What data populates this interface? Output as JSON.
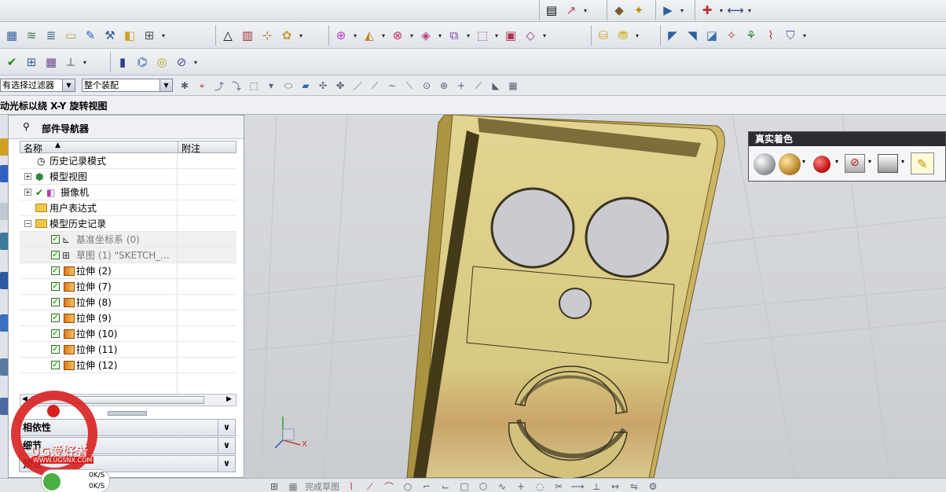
{
  "toolbar": {
    "filter_select": "有选择过滤器",
    "assembly_select": "整个装配"
  },
  "view_title": "动光标以绕 X-Y 旋转视图",
  "navigator": {
    "title": "部件导航器",
    "col_name": "名称",
    "col_note": "附注",
    "items": [
      {
        "label": "历史记录模式"
      },
      {
        "label": "模型视图"
      },
      {
        "label": "摄像机"
      },
      {
        "label": "用户表达式"
      },
      {
        "label": "模型历史记录"
      },
      {
        "label": "基准坐标系 (0)"
      },
      {
        "label": "草图 (1) \"SKETCH_..."
      },
      {
        "label": "拉伸 (2)"
      },
      {
        "label": "拉伸 (7)"
      },
      {
        "label": "拉伸 (8)"
      },
      {
        "label": "拉伸 (9)"
      },
      {
        "label": "拉伸 (10)"
      },
      {
        "label": "拉伸 (11)"
      },
      {
        "label": "拉伸 (12)"
      }
    ],
    "panels": [
      {
        "label": "相依性"
      },
      {
        "label": "细节"
      },
      {
        "label": "预览"
      }
    ]
  },
  "shading_palette": {
    "title": "真实着色"
  },
  "status_bar": {
    "speed1": "0K/S",
    "speed2": "0K/S",
    "sketch_label": "完成草图"
  },
  "watermark": {
    "text": "UG爱好者",
    "url": "WWW.UGSNX.COM"
  },
  "axis_label": "X",
  "colors": {
    "part": "#d8c87e",
    "accent": "#1b7a1b",
    "viewport": "#d2d4d8"
  }
}
